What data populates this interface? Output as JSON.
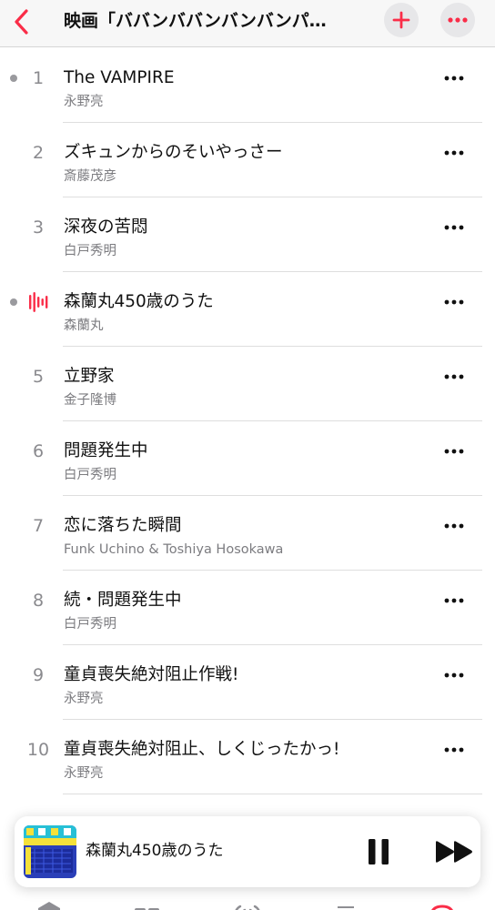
{
  "colors": {
    "accent": "#fa2d48",
    "secondary_text": "#7c7c80",
    "header_bg": "#f7f7f7"
  },
  "header": {
    "back_icon": "chevron-left-icon",
    "title": "映画「ババンババンバンバンパ…",
    "add_icon": "plus-icon",
    "more_icon": "ellipsis-icon"
  },
  "tracks": [
    {
      "number": "1",
      "title": "The VAMPIRE",
      "artist": "永野亮",
      "bullet": true,
      "playing": false
    },
    {
      "number": "2",
      "title": "ズキュンからのそいやっさー",
      "artist": "斎藤茂彦",
      "bullet": false,
      "playing": false
    },
    {
      "number": "3",
      "title": "深夜の苦悶",
      "artist": "白戸秀明",
      "bullet": false,
      "playing": false
    },
    {
      "number": "4",
      "title": "森蘭丸450歳のうた",
      "artist": "森蘭丸",
      "bullet": true,
      "playing": true
    },
    {
      "number": "5",
      "title": "立野家",
      "artist": "金子隆博",
      "bullet": false,
      "playing": false
    },
    {
      "number": "6",
      "title": "問題発生中",
      "artist": "白戸秀明",
      "bullet": false,
      "playing": false
    },
    {
      "number": "7",
      "title": "恋に落ちた瞬間",
      "artist": "Funk Uchino & Toshiya Hosokawa",
      "bullet": false,
      "playing": false
    },
    {
      "number": "8",
      "title": "続・問題発生中",
      "artist": "白戸秀明",
      "bullet": false,
      "playing": false
    },
    {
      "number": "9",
      "title": "童貞喪失絶対阻止作戦!",
      "artist": "永野亮",
      "bullet": false,
      "playing": false
    },
    {
      "number": "10",
      "title": "童貞喪失絶対阻止、しくじったかっ!",
      "artist": "永野亮",
      "bullet": false,
      "playing": false
    }
  ],
  "now_playing": {
    "title": "森蘭丸450歳のうた",
    "artwork": "album-artwork",
    "pause_icon": "pause-icon",
    "next_icon": "fast-forward-icon"
  },
  "tab_bar": {
    "icons": [
      "home-icon",
      "grid-icon",
      "radio-icon",
      "library-icon",
      "search-icon"
    ]
  }
}
